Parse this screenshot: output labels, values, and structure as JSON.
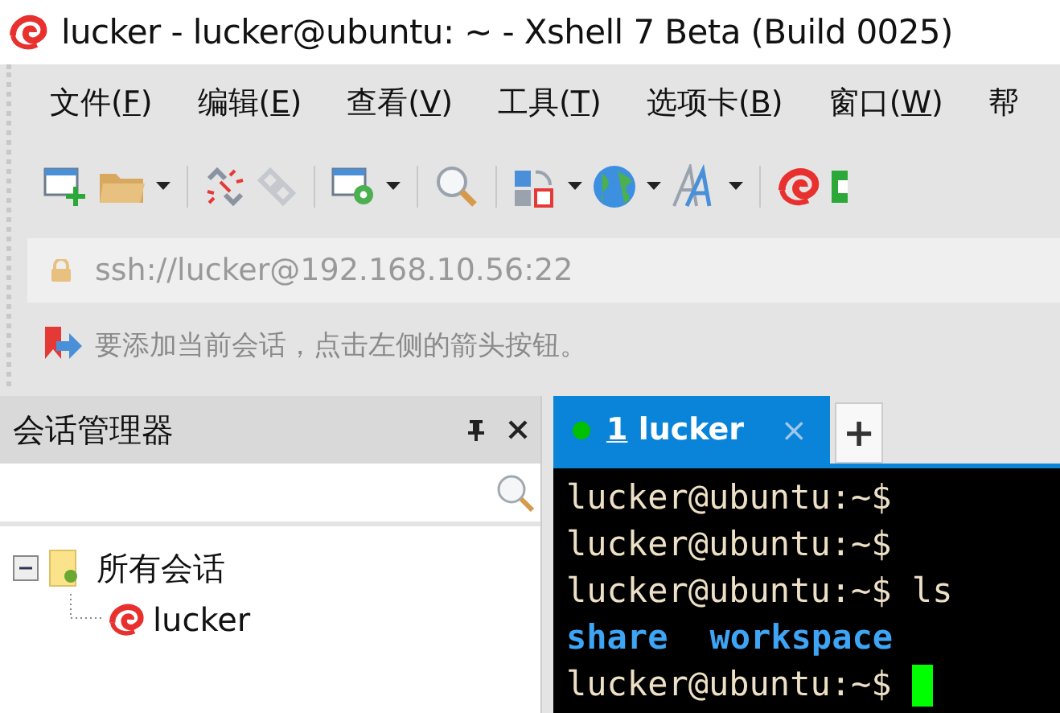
{
  "window": {
    "title": "lucker - lucker@ubuntu: ~ - Xshell 7 Beta (Build 0025)"
  },
  "menu": [
    {
      "label": "文件(",
      "mnemonic": "F",
      "suffix": ")"
    },
    {
      "label": "编辑(",
      "mnemonic": "E",
      "suffix": ")"
    },
    {
      "label": "查看(",
      "mnemonic": "V",
      "suffix": ")"
    },
    {
      "label": "工具(",
      "mnemonic": "T",
      "suffix": ")"
    },
    {
      "label": "选项卡(",
      "mnemonic": "B",
      "suffix": ")"
    },
    {
      "label": "窗口(",
      "mnemonic": "W",
      "suffix": ")"
    },
    {
      "label": "帮"
    }
  ],
  "address_bar": {
    "value": "ssh://lucker@192.168.10.56:22"
  },
  "hint_bar": {
    "text": "要添加当前会话，点击左侧的箭头按钮。"
  },
  "session_manager": {
    "title": "会话管理器",
    "tree": [
      {
        "label": "所有会话",
        "expanded": true,
        "children": [
          {
            "label": "lucker"
          }
        ]
      }
    ]
  },
  "tabs": [
    {
      "number": "1",
      "label": "lucker",
      "selected": true,
      "color": "#00c000",
      "close": "×"
    }
  ],
  "new_tab": "+",
  "terminal": [
    {
      "kind": "prompt",
      "text": "lucker@ubuntu:~$"
    },
    {
      "kind": "prompt",
      "text": "lucker@ubuntu:~$"
    },
    {
      "kind": "prompt",
      "text": "lucker@ubuntu:~$ ls"
    },
    {
      "kind": "output",
      "items": [
        "share",
        "workspace"
      ]
    },
    {
      "kind": "prompt",
      "text": "lucker@ubuntu:~$ ",
      "cursor": true
    }
  ]
}
